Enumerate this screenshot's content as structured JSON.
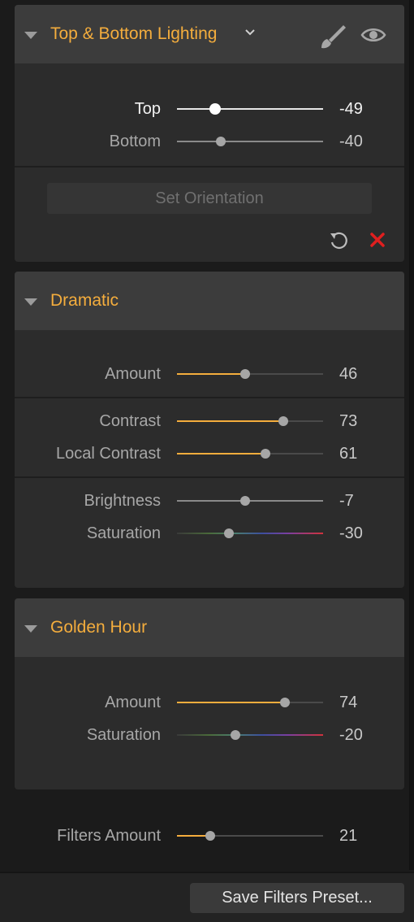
{
  "panels": [
    {
      "title": "Top & Bottom Lighting",
      "rows": [
        {
          "label": "Top",
          "value": "-49"
        },
        {
          "label": "Bottom",
          "value": "-40"
        }
      ],
      "set_orientation_label": "Set Orientation"
    },
    {
      "title": "Dramatic",
      "rows": [
        {
          "label": "Amount",
          "value": "46"
        },
        {
          "label": "Contrast",
          "value": "73"
        },
        {
          "label": "Local Contrast",
          "value": "61"
        },
        {
          "label": "Brightness",
          "value": "-7"
        },
        {
          "label": "Saturation",
          "value": "-30"
        }
      ]
    },
    {
      "title": "Golden Hour",
      "rows": [
        {
          "label": "Amount",
          "value": "74"
        },
        {
          "label": "Saturation",
          "value": "-20"
        }
      ]
    }
  ],
  "filters_amount": {
    "label": "Filters Amount",
    "value": "21"
  },
  "save_preset_label": "Save Filters Preset...",
  "icons": {
    "collapse": "triangle-down-icon",
    "title_menu": "chevron-down-icon",
    "mask": "brush-icon",
    "visibility": "eye-icon",
    "reset": "reset-icon",
    "remove": "close-icon"
  },
  "colors": {
    "accent": "#f4ad3d",
    "remove": "#e01f1f",
    "panel_bg": "#2c2c2c",
    "header_bg": "#3c3c3c"
  }
}
